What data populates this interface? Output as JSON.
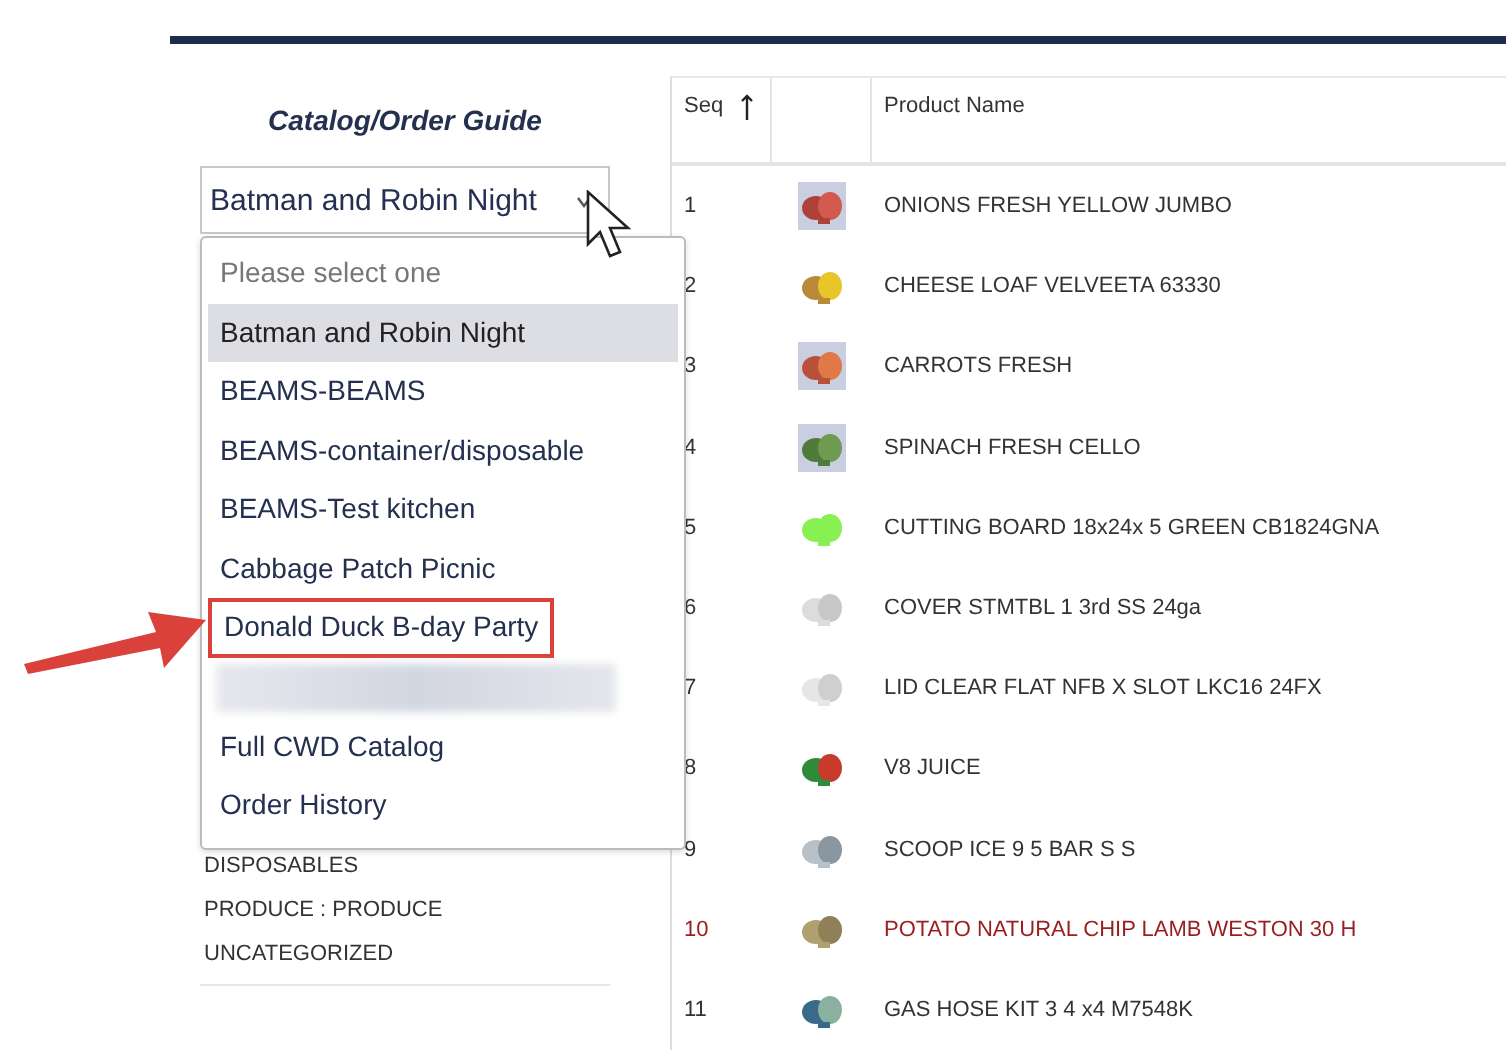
{
  "sidebar": {
    "title": "Catalog/Order Guide",
    "select": {
      "value": "Batman and Robin Night",
      "expanded": true
    },
    "options": [
      {
        "kind": "placeholder",
        "label": "Please select one",
        "selected": false
      },
      {
        "kind": "option",
        "label": "Batman and Robin Night",
        "selected": true,
        "annotated": false
      },
      {
        "kind": "option",
        "label": "BEAMS-BEAMS",
        "selected": false,
        "annotated": false
      },
      {
        "kind": "option",
        "label": "BEAMS-container/disposable",
        "selected": false,
        "annotated": false
      },
      {
        "kind": "option",
        "label": "BEAMS-Test kitchen",
        "selected": false,
        "annotated": false
      },
      {
        "kind": "option",
        "label": "Cabbage Patch Picnic",
        "selected": false,
        "annotated": false
      },
      {
        "kind": "option",
        "label": "Donald Duck B-day Party",
        "selected": false,
        "annotated": true
      },
      {
        "kind": "redacted"
      },
      {
        "kind": "option",
        "label": "Full CWD Catalog",
        "selected": false,
        "annotated": false
      },
      {
        "kind": "option",
        "label": "Order History",
        "selected": false,
        "annotated": false
      }
    ],
    "categories": [
      "DISPOSABLES",
      "PRODUCE : PRODUCE",
      "UNCATEGORIZED"
    ]
  },
  "table": {
    "columns": [
      {
        "label": "Seq",
        "sorted": true
      },
      {},
      {
        "label": "Product Name"
      }
    ],
    "rows": [
      {
        "seq": "1",
        "name": "ONIONS FRESH YELLOW JUMBO",
        "highlighted": false
      },
      {
        "seq": "2",
        "name": "CHEESE LOAF VELVEETA 63330",
        "highlighted": false
      },
      {
        "seq": "3",
        "name": "CARROTS FRESH",
        "highlighted": false
      },
      {
        "seq": "4",
        "name": "SPINACH FRESH CELLO",
        "highlighted": false
      },
      {
        "seq": "5",
        "name": "CUTTING BOARD 18x24x 5 GREEN CB1824GNA",
        "highlighted": false
      },
      {
        "seq": "6",
        "name": "COVER STMTBL 1 3rd SS 24ga",
        "highlighted": false
      },
      {
        "seq": "7",
        "name": "LID CLEAR FLAT NFB X SLOT LKC16 24FX",
        "highlighted": false
      },
      {
        "seq": "8",
        "name": "V8 JUICE",
        "highlighted": false
      },
      {
        "seq": "9",
        "name": "SCOOP ICE 9 5 BAR S S",
        "highlighted": false
      },
      {
        "seq": "10",
        "name": "POTATO NATURAL CHIP LAMB WESTON 30 H",
        "highlighted": true
      },
      {
        "seq": "11",
        "name": "GAS HOSE KIT 3 4 x4 M7548K",
        "highlighted": false
      }
    ]
  }
}
